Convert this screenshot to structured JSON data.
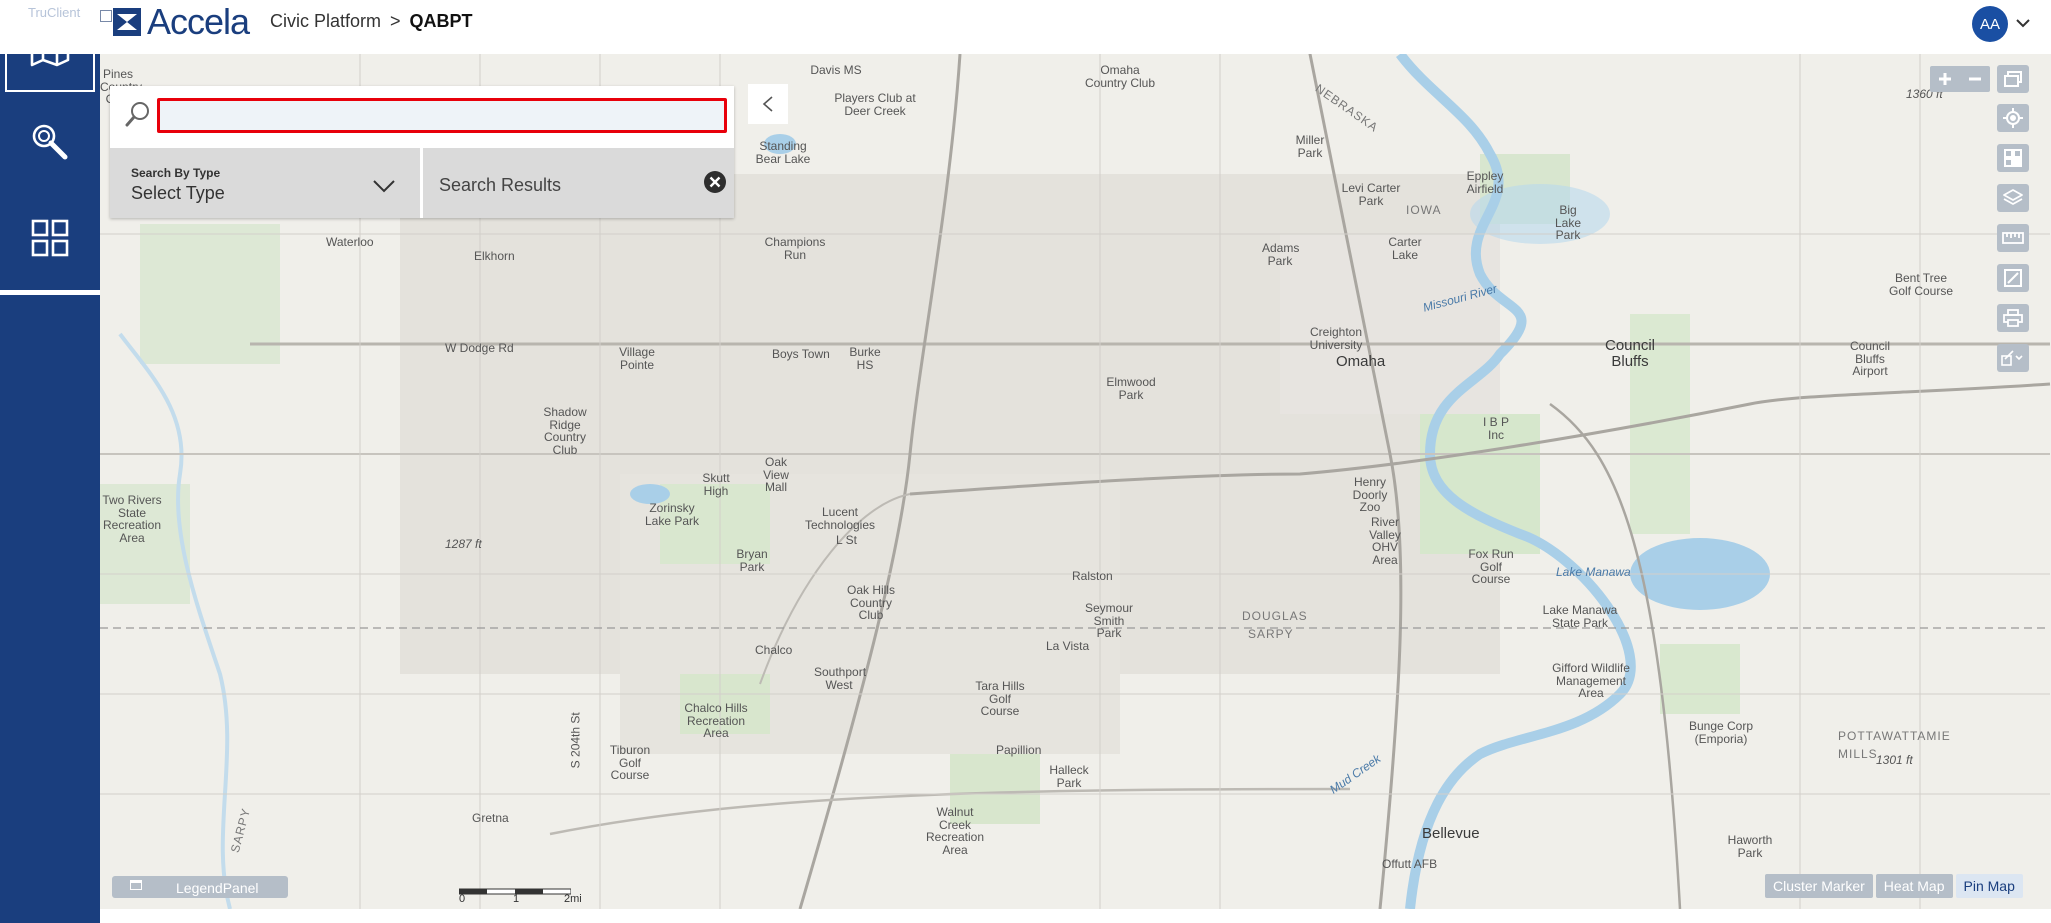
{
  "header": {
    "logo_text": "Accela",
    "breadcrumb_root": "Civic Platform",
    "breadcrumb_separator": ">",
    "breadcrumb_current": "QABPT",
    "user_initials": "AA"
  },
  "overlay": {
    "truclient_label": "TruClient"
  },
  "sidebar": {
    "items": [
      {
        "name": "map",
        "icon": "map-icon",
        "active": true
      },
      {
        "name": "search",
        "icon": "search-icon",
        "active": false
      },
      {
        "name": "apps",
        "icon": "apps-grid-icon",
        "active": false
      }
    ]
  },
  "search_panel": {
    "input_value": "",
    "input_placeholder": "",
    "type_label": "Search By Type",
    "type_value": "Select Type",
    "results_label": "Search Results"
  },
  "map": {
    "labels": [
      "Davis MS",
      "Players Club at Deer Creek",
      "Omaha Country Club",
      "Standing Bear Lake",
      "Miller Park",
      "NEBRASKA",
      "Levi Carter Park",
      "IOWA",
      "Eppley Airfield",
      "Big Lake Park",
      "Carter Lake",
      "Adams Park",
      "Missouri River",
      "Waterloo",
      "Elkhorn",
      "Champions Run",
      "W Dodge Rd",
      "Village Pointe",
      "Boys Town",
      "Burke HS",
      "Creighton University",
      "Omaha",
      "Council Bluffs",
      "Council Bluffs Airport",
      "Bent Tree Golf Course",
      "Shadow Ridge Country Club",
      "Elmwood Park",
      "I B P Inc",
      "Oak View Mall",
      "Skutt High",
      "Zorinsky Lake Park",
      "Henry Doorly Zoo",
      "Two Rivers State Recreation Area",
      "1287 ft",
      "Lucent Technologies",
      "L St",
      "River Valley OHV Area",
      "Fox Run Golf Course",
      "Lake Manawa",
      "Bryan Park",
      "Oak Hills Country Club",
      "Ralston",
      "Seymour Smith Park",
      "DOUGLAS",
      "SARPY",
      "Lake Manawa State Park",
      "Chalco",
      "La Vista",
      "Southport West",
      "Gifford Wildlife Management Area",
      "Tara Hills Golf Course",
      "Chalco Hills Recreation Area",
      "Papillion",
      "Bunge Corp (Emporia)",
      "POTTAWATTAMIE",
      "MILLS",
      "Tiburon Golf Course",
      "1301 ft",
      "Halleck Park",
      "Mud Creek",
      "Gretna",
      "Walnut Creek Recreation Area",
      "Bellevue",
      "Haworth Park",
      "Offutt AFB",
      "1360 ft",
      "Pines Country Club",
      "S 204th St",
      "SARPY"
    ]
  },
  "legend": {
    "label": "LegendPanel"
  },
  "scale": {
    "labels": [
      "0",
      "1",
      "2mi"
    ]
  },
  "view_modes": {
    "cluster": "Cluster Marker",
    "heat": "Heat Map",
    "pin": "Pin Map",
    "active": "pin"
  },
  "colors": {
    "brand": "#1a3e7e",
    "avatar": "#1a4fa3",
    "input_border": "#e8000b",
    "map_bg": "#f0efea",
    "tool_bg": "#b5bec8"
  }
}
